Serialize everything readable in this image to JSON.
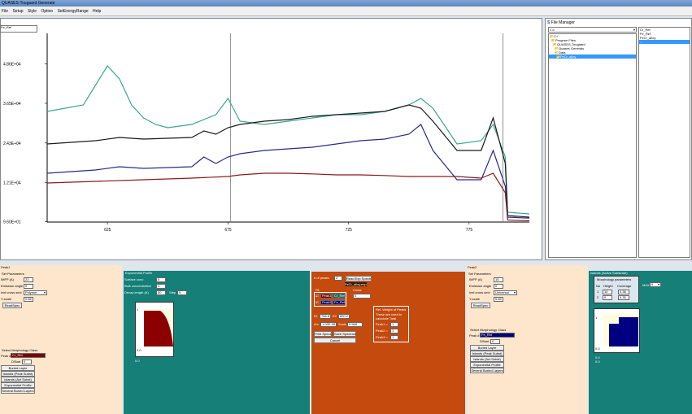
{
  "window": {
    "title": "QUASES-Tougaard Generate",
    "menu": [
      "File",
      "Setup",
      "Style",
      "Option",
      "SetEnergyRange",
      "Help"
    ],
    "file_box_value": "Fe_Ref"
  },
  "chart_data": {
    "type": "line",
    "y_tick_labels": [
      "4.86E+04",
      "3.65E+04",
      "2.43E+04",
      "1.21E+04",
      "9.60E+01"
    ],
    "x_tick_labels": [
      "625",
      "675",
      "725",
      "775"
    ],
    "xlim": [
      600,
      800
    ],
    "ylim": [
      0,
      58000
    ],
    "vertical_markers_x": [
      676,
      789
    ],
    "series": [
      {
        "color": "#3aa68e",
        "x": [
          600,
          615,
          620,
          625,
          630,
          635,
          640,
          645,
          650,
          660,
          670,
          675,
          680,
          690,
          700,
          710,
          720,
          730,
          740,
          750,
          755,
          760,
          770,
          780,
          785,
          790,
          791,
          800
        ],
        "y": [
          34000,
          36000,
          42000,
          48000,
          44000,
          36000,
          32000,
          30000,
          29000,
          30000,
          33000,
          38000,
          31000,
          30000,
          31000,
          32000,
          33000,
          33000,
          34000,
          36000,
          38000,
          35000,
          24000,
          25000,
          30000,
          20000,
          3000,
          2500
        ]
      },
      {
        "color": "#1a1a1a",
        "x": [
          600,
          620,
          630,
          640,
          660,
          665,
          670,
          675,
          680,
          690,
          700,
          710,
          720,
          730,
          740,
          750,
          755,
          760,
          770,
          780,
          785,
          790,
          791,
          800
        ],
        "y": [
          24000,
          25000,
          26000,
          25500,
          26000,
          28000,
          27000,
          29000,
          30000,
          31000,
          31500,
          32500,
          33000,
          33500,
          34000,
          36000,
          35000,
          31000,
          22000,
          22000,
          32000,
          18000,
          2000,
          1500
        ]
      },
      {
        "color": "#2a2a8f",
        "x": [
          600,
          620,
          630,
          640,
          660,
          665,
          670,
          675,
          680,
          690,
          700,
          710,
          720,
          730,
          740,
          750,
          755,
          760,
          770,
          780,
          785,
          790,
          791,
          800
        ],
        "y": [
          15000,
          16000,
          17000,
          16500,
          17000,
          20000,
          18000,
          20000,
          21000,
          22000,
          22500,
          23000,
          24000,
          25000,
          25500,
          27000,
          30000,
          22000,
          13000,
          13000,
          22000,
          11000,
          1500,
          1200
        ]
      },
      {
        "color": "#8b1a1a",
        "x": [
          600,
          620,
          640,
          660,
          675,
          680,
          690,
          700,
          710,
          720,
          730,
          740,
          750,
          760,
          770,
          780,
          785,
          790,
          791,
          800
        ],
        "y": [
          12000,
          12500,
          13000,
          13500,
          14000,
          14500,
          15000,
          15000,
          14800,
          14500,
          14500,
          14300,
          14000,
          14000,
          14000,
          13500,
          15000,
          9000,
          600,
          400
        ]
      }
    ]
  },
  "file_manager": {
    "title": "File Manager",
    "drive": "\\\\ c:",
    "dirs": [
      "C:\\",
      "Program Files",
      "QUASES-Tougaard",
      "Quases Generals",
      "Data",
      "FeCr_alloy"
    ],
    "files": [
      "Cr_Ref",
      "Fe_Ref",
      "FeCr_alloy",
      "..."
    ]
  },
  "left_panel": {
    "title": "Peak1",
    "section": "Set Parameters",
    "imfp_label": "IMFP (A)",
    "imfp_value": "22",
    "emission_label": "Emission angle",
    "emission_value": "0",
    "inel_label": "Inel cross sect",
    "inel_value": "Polymer",
    "yscale_label": "Y-scale",
    "yscale_value": "0.65",
    "read_button": "ReadSpec",
    "morph_title": "Select Morphology Class",
    "peak_label": "Peak #",
    "peak_value": "Cr_Ref",
    "dstart_label": "DStart",
    "dstart_value": "0",
    "buttons": [
      "Buried Layer",
      "Islands (Peak Subst)",
      "Islands (Act Subst)",
      "Exponential Profile",
      "Several Buried Layers"
    ]
  },
  "exp_panel": {
    "title": "Exponential Profile",
    "surface_label": "Surface conc",
    "surface_value": "0",
    "bulk_label": "Bulk concentration",
    "bulk_value": "1",
    "decay_label": "Decay length (A)",
    "decay_value": "50",
    "step_label": "Step",
    "step_value": "5",
    "plot_top": "1",
    "plot_bottom": "0.0",
    "plot_corner": "0.0"
  },
  "center_panel": {
    "peaks_label": "# of peaks",
    "peaks_value": "2",
    "read_exp_button": "Read Exp Spectr",
    "exp_file": "FeCr_alloy.exp",
    "cross_label": "Cross",
    "cross_value": "0",
    "fit_label": "Fit",
    "peak1": "Peak1",
    "peak1_val": "Cr_Ref",
    "peak2": "Peak2",
    "peak2_val": "Fe_Ref",
    "e1_label": "E1",
    "e1_value": "756.8",
    "e2_label": "E2",
    "e2_value": "800.2",
    "ax_label": "A/x",
    "ax_value": "1.02E-05",
    "scale_label": "Scale",
    "scale_value": "0.568",
    "print_button": "Print Specs",
    "save_button": "Save Spectrum",
    "cancel_button": "Cancel",
    "weights_title": "Rel. Weight of Peaks",
    "weights_note1": "These are used to",
    "weights_note2": "calculate Total",
    "weights": [
      {
        "label": "Peak1 =",
        "value": "1"
      },
      {
        "label": "Peak2 =",
        "value": "1"
      },
      {
        "label": "Peak3 =",
        "value": "1"
      }
    ]
  },
  "right_panel": {
    "title": "Peak2",
    "section": "Set Parameters",
    "imfp_label": "IMFP (A)",
    "imfp_value": "15",
    "emission_label": "Emission angle",
    "emission_value": "0",
    "inel_label": "Inel cross sect",
    "inel_value": "Universal",
    "yscale_label": "Y-scale",
    "yscale_value": "0.65",
    "read_button": "ReadSpec",
    "morph_title": "Select Morphology Class",
    "peak_label": "Peak #",
    "peak_value": "Fe_Ref",
    "dstart_label": "DStart",
    "dstart_value": "0",
    "buttons": [
      "Buried Layer",
      "Islands (Peak Subst)",
      "Islands (Act Subst)",
      "Exponential Profile",
      "Several Buried Layers"
    ]
  },
  "islands_panel": {
    "title": "Islands (Active Substrate)",
    "morph_params": "Morphology parameters",
    "col_no": "No",
    "col_height": "Height",
    "col_coverage": "Coverage",
    "rows": [
      {
        "no": "1",
        "height": "10",
        "coverage": "0.38"
      },
      {
        "no": "2",
        "height": "0",
        "coverage": "0.35"
      }
    ],
    "max_label": "MAX",
    "max_value": "5",
    "plot_top": "1",
    "plot_bottom": "0.0",
    "plot_corner1": "0.0",
    "plot_corner2": "0.0"
  }
}
